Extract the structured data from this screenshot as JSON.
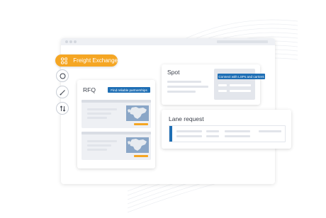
{
  "sidebar": {
    "active_item": {
      "label": "Freight Exchange",
      "icon": "grid-icon"
    },
    "tools": [
      {
        "icon": "circle-icon"
      },
      {
        "icon": "pen-icon"
      },
      {
        "icon": "swap-icon"
      }
    ]
  },
  "cards": {
    "rfq": {
      "title": "RFQ",
      "button_label": "Find reliable partnerships"
    },
    "spot": {
      "title": "Spot",
      "button_label": "Connect with LSPs and carriers"
    },
    "lane": {
      "title": "Lane request"
    }
  },
  "colors": {
    "accent_orange": "#f5a623",
    "accent_blue": "#1f6fb5",
    "map_water": "#8aa6c7"
  }
}
